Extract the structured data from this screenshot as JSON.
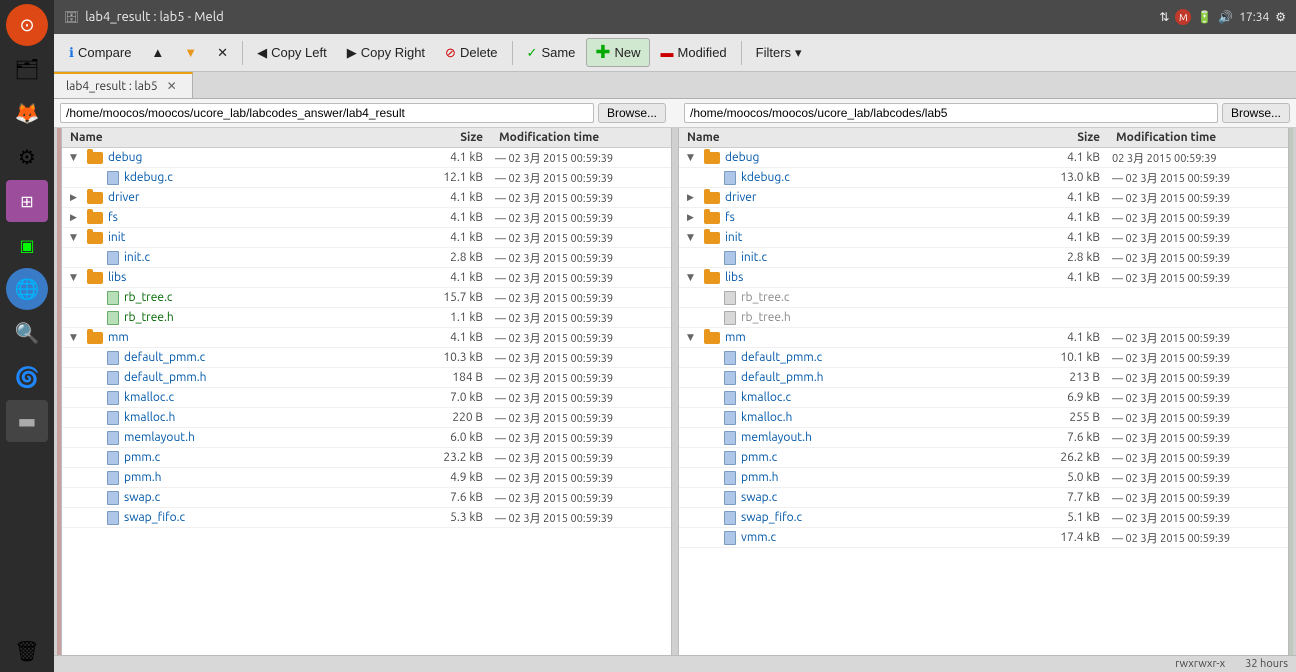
{
  "window": {
    "title": "lab4_result : lab5 - Meld",
    "time": "17:34"
  },
  "toolbar": {
    "compare_label": "Compare",
    "copy_left_label": "Copy Left",
    "copy_right_label": "Copy Right",
    "delete_label": "Delete",
    "same_label": "Same",
    "new_label": "New",
    "modified_label": "Modified",
    "filters_label": "Filters"
  },
  "tab": {
    "label": "lab4_result : lab5"
  },
  "left_pane": {
    "path": "/home/moocos/moocos/ucore_lab/labcodes_answer/lab4_result",
    "browse_label": "Browse...",
    "columns": {
      "name": "Name",
      "size": "Size",
      "date": "Modification time"
    },
    "files": [
      {
        "indent": 1,
        "type": "folder",
        "toggle": "▼",
        "name": "debug",
        "size": "4.1 kB",
        "date": "— 02 3月 2015 00:59:39"
      },
      {
        "indent": 2,
        "type": "file-blue",
        "toggle": "",
        "name": "kdebug.c",
        "size": "12.1 kB",
        "date": "— 02 3月 2015 00:59:39",
        "color": "blue"
      },
      {
        "indent": 1,
        "type": "folder",
        "toggle": "▶",
        "name": "driver",
        "size": "4.1 kB",
        "date": "— 02 3月 2015 00:59:39"
      },
      {
        "indent": 1,
        "type": "folder",
        "toggle": "▶",
        "name": "fs",
        "size": "4.1 kB",
        "date": "— 02 3月 2015 00:59:39"
      },
      {
        "indent": 1,
        "type": "folder",
        "toggle": "▼",
        "name": "init",
        "size": "4.1 kB",
        "date": "— 02 3月 2015 00:59:39"
      },
      {
        "indent": 2,
        "type": "file-blue",
        "toggle": "",
        "name": "init.c",
        "size": "2.8 kB",
        "date": "— 02 3月 2015 00:59:39",
        "color": "blue"
      },
      {
        "indent": 1,
        "type": "folder",
        "toggle": "▼",
        "name": "libs",
        "size": "4.1 kB",
        "date": "— 02 3月 2015 00:59:39"
      },
      {
        "indent": 2,
        "type": "file-green",
        "toggle": "",
        "name": "rb_tree.c",
        "size": "15.7 kB",
        "date": "— 02 3月 2015 00:59:39",
        "color": "green"
      },
      {
        "indent": 2,
        "type": "file-green",
        "toggle": "",
        "name": "rb_tree.h",
        "size": "1.1 kB",
        "date": "— 02 3月 2015 00:59:39",
        "color": "green"
      },
      {
        "indent": 1,
        "type": "folder",
        "toggle": "▼",
        "name": "mm",
        "size": "4.1 kB",
        "date": "— 02 3月 2015 00:59:39"
      },
      {
        "indent": 2,
        "type": "file-blue",
        "toggle": "",
        "name": "default_pmm.c",
        "size": "10.3 kB",
        "date": "— 02 3月 2015 00:59:39",
        "color": "blue"
      },
      {
        "indent": 2,
        "type": "file-blue",
        "toggle": "",
        "name": "default_pmm.h",
        "size": "184 B",
        "date": "— 02 3月 2015 00:59:39",
        "color": "blue"
      },
      {
        "indent": 2,
        "type": "file-blue",
        "toggle": "",
        "name": "kmalloc.c",
        "size": "7.0 kB",
        "date": "— 02 3月 2015 00:59:39",
        "color": "blue"
      },
      {
        "indent": 2,
        "type": "file-blue",
        "toggle": "",
        "name": "kmalloc.h",
        "size": "220 B",
        "date": "— 02 3月 2015 00:59:39",
        "color": "blue"
      },
      {
        "indent": 2,
        "type": "file-blue",
        "toggle": "",
        "name": "memlayout.h",
        "size": "6.0 kB",
        "date": "— 02 3月 2015 00:59:39",
        "color": "blue"
      },
      {
        "indent": 2,
        "type": "file-blue",
        "toggle": "",
        "name": "pmm.c",
        "size": "23.2 kB",
        "date": "— 02 3月 2015 00:59:39",
        "color": "blue"
      },
      {
        "indent": 2,
        "type": "file-blue",
        "toggle": "",
        "name": "pmm.h",
        "size": "4.9 kB",
        "date": "— 02 3月 2015 00:59:39",
        "color": "blue"
      },
      {
        "indent": 2,
        "type": "file-blue",
        "toggle": "",
        "name": "swap.c",
        "size": "7.6 kB",
        "date": "— 02 3月 2015 00:59:39",
        "color": "blue"
      },
      {
        "indent": 2,
        "type": "file-blue",
        "toggle": "",
        "name": "swap_fifo.c",
        "size": "5.3 kB",
        "date": "— 02 3月 2015 00:59:39",
        "color": "blue"
      }
    ]
  },
  "right_pane": {
    "path": "/home/moocos/moocos/ucore_lab/labcodes/lab5",
    "browse_label": "Browse...",
    "columns": {
      "name": "Name",
      "size": "Size",
      "date": "Modification time"
    },
    "files": [
      {
        "indent": 1,
        "type": "folder",
        "toggle": "▼",
        "name": "debug",
        "size": "4.1 kB",
        "date": "02 3月 2015 00:59:39"
      },
      {
        "indent": 2,
        "type": "file-blue",
        "toggle": "",
        "name": "kdebug.c",
        "size": "13.0 kB",
        "date": "— 02 3月 2015 00:59:39",
        "color": "blue"
      },
      {
        "indent": 1,
        "type": "folder",
        "toggle": "▶",
        "name": "driver",
        "size": "4.1 kB",
        "date": "— 02 3月 2015 00:59:39"
      },
      {
        "indent": 1,
        "type": "folder",
        "toggle": "▶",
        "name": "fs",
        "size": "4.1 kB",
        "date": "— 02 3月 2015 00:59:39"
      },
      {
        "indent": 1,
        "type": "folder",
        "toggle": "▼",
        "name": "init",
        "size": "4.1 kB",
        "date": "— 02 3月 2015 00:59:39"
      },
      {
        "indent": 2,
        "type": "file-blue",
        "toggle": "",
        "name": "init.c",
        "size": "2.8 kB",
        "date": "— 02 3月 2015 00:59:39",
        "color": "blue"
      },
      {
        "indent": 1,
        "type": "folder",
        "toggle": "▼",
        "name": "libs",
        "size": "4.1 kB",
        "date": "— 02 3月 2015 00:59:39"
      },
      {
        "indent": 2,
        "type": "file-gray",
        "toggle": "",
        "name": "rb_tree.c",
        "size": "",
        "date": "",
        "color": "gray"
      },
      {
        "indent": 2,
        "type": "file-gray",
        "toggle": "",
        "name": "rb_tree.h",
        "size": "",
        "date": "",
        "color": "gray"
      },
      {
        "indent": 1,
        "type": "folder",
        "toggle": "▼",
        "name": "mm",
        "size": "4.1 kB",
        "date": "— 02 3月 2015 00:59:39"
      },
      {
        "indent": 2,
        "type": "file-blue",
        "toggle": "",
        "name": "default_pmm.c",
        "size": "10.1 kB",
        "date": "— 02 3月 2015 00:59:39",
        "color": "blue"
      },
      {
        "indent": 2,
        "type": "file-blue",
        "toggle": "",
        "name": "default_pmm.h",
        "size": "213 B",
        "date": "— 02 3月 2015 00:59:39",
        "color": "blue"
      },
      {
        "indent": 2,
        "type": "file-blue",
        "toggle": "",
        "name": "kmalloc.c",
        "size": "6.9 kB",
        "date": "— 02 3月 2015 00:59:39",
        "color": "blue"
      },
      {
        "indent": 2,
        "type": "file-blue",
        "toggle": "",
        "name": "kmalloc.h",
        "size": "255 B",
        "date": "— 02 3月 2015 00:59:39",
        "color": "blue"
      },
      {
        "indent": 2,
        "type": "file-blue",
        "toggle": "",
        "name": "memlayout.h",
        "size": "7.6 kB",
        "date": "— 02 3月 2015 00:59:39",
        "color": "blue"
      },
      {
        "indent": 2,
        "type": "file-blue",
        "toggle": "",
        "name": "pmm.c",
        "size": "26.2 kB",
        "date": "— 02 3月 2015 00:59:39",
        "color": "blue"
      },
      {
        "indent": 2,
        "type": "file-blue",
        "toggle": "",
        "name": "pmm.h",
        "size": "5.0 kB",
        "date": "— 02 3月 2015 00:59:39",
        "color": "blue"
      },
      {
        "indent": 2,
        "type": "file-blue",
        "toggle": "",
        "name": "swap.c",
        "size": "7.7 kB",
        "date": "— 02 3月 2015 00:59:39",
        "color": "blue"
      },
      {
        "indent": 2,
        "type": "file-blue",
        "toggle": "",
        "name": "swap_fifo.c",
        "size": "5.1 kB",
        "date": "— 02 3月 2015 00:59:39",
        "color": "blue"
      },
      {
        "indent": 2,
        "type": "file-blue",
        "toggle": "",
        "name": "vmm.c",
        "size": "17.4 kB",
        "date": "— 02 3月 2015 00:59:39",
        "color": "blue"
      }
    ]
  },
  "statusbar": {
    "permissions": "rwxrwxr-x",
    "time_label": "32 hours"
  },
  "sidebar_icons": [
    {
      "name": "ubuntu",
      "symbol": "⊙"
    },
    {
      "name": "files",
      "symbol": "🗂"
    },
    {
      "name": "firefox",
      "symbol": "🦊"
    },
    {
      "name": "settings",
      "symbol": "⚙"
    },
    {
      "name": "apps",
      "symbol": "⊞"
    },
    {
      "name": "terminal",
      "symbol": "▣"
    },
    {
      "name": "globe",
      "symbol": "🌐"
    },
    {
      "name": "search",
      "symbol": "🔍"
    },
    {
      "name": "swirl",
      "symbol": "🌀"
    },
    {
      "name": "screen",
      "symbol": "▬"
    },
    {
      "name": "trash",
      "symbol": "🗑"
    }
  ]
}
